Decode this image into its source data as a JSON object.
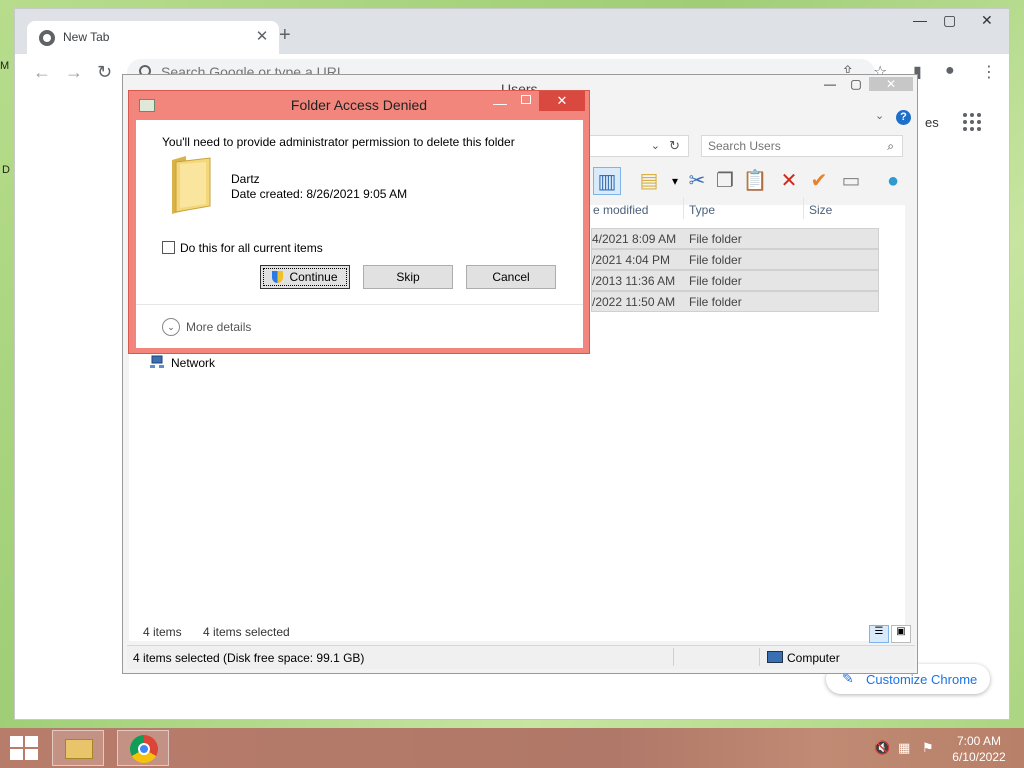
{
  "desktop": {
    "stray_m": "M",
    "stray_d": "D"
  },
  "chrome": {
    "tab_title": "New Tab",
    "tab_close": "✕",
    "new_tab": "+",
    "win_min": "—",
    "win_max": "▢",
    "win_close": "✕",
    "omnibox_placeholder": "Search Google or type a URL",
    "images_link": "es",
    "customize_label": "Customize Chrome"
  },
  "explorer": {
    "title": "Users",
    "search_placeholder": "Search Users",
    "columns": {
      "date": "e modified",
      "type": "Type",
      "size": "Size"
    },
    "rows": [
      {
        "date": "4/2021 8:09 AM",
        "type": "File folder"
      },
      {
        "date": "/2021 4:04 PM",
        "type": "File folder"
      },
      {
        "date": "/2013 11:36 AM",
        "type": "File folder"
      },
      {
        "date": "/2022 11:50 AM",
        "type": "File folder"
      }
    ],
    "nav_network": "Network",
    "items_count": "4 items",
    "items_selected": "4 items selected",
    "statusbar_left": "4 items selected (Disk free space: 99.1 GB)",
    "statusbar_right": "Computer"
  },
  "dialog": {
    "title": "Folder Access Denied",
    "message": "You'll need to provide administrator permission to delete this folder",
    "folder_name": "Dartz",
    "date_created": "Date created: 8/26/2021 9:05 AM",
    "checkbox_label": "Do this for all current items",
    "continue_label": "Continue",
    "skip_label": "Skip",
    "cancel_label": "Cancel",
    "more_details": "More details"
  },
  "taskbar": {
    "time": "7:00 AM",
    "date": "6/10/2022"
  },
  "colors": {
    "dialog_frame": "#f2867d",
    "dialog_close": "#d9493f",
    "chrome_accent": "#1a73e8",
    "taskbar": "#b87c6a"
  }
}
